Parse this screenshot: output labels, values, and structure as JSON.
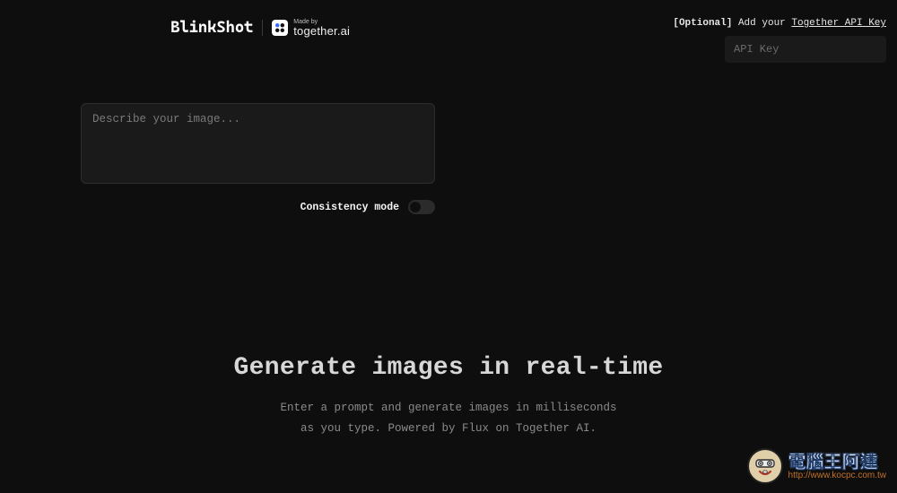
{
  "header": {
    "logo": "BlinkShot",
    "madeby_label": "Made by",
    "madeby_brand": "together.ai"
  },
  "api": {
    "hint_prefix": "[Optional]",
    "hint_mid": " Add your ",
    "hint_link": "Together API Key",
    "placeholder": "API Key"
  },
  "prompt": {
    "placeholder": "Describe your image..."
  },
  "consistency": {
    "label": "Consistency mode",
    "enabled": false
  },
  "hero": {
    "title": "Generate images in real-time",
    "subtitle_line1": "Enter a prompt and generate images in milliseconds",
    "subtitle_line2": "as you type. Powered by Flux on Together AI."
  },
  "watermark": {
    "text": "電腦王阿達",
    "url": "http://www.kocpc.com.tw"
  }
}
